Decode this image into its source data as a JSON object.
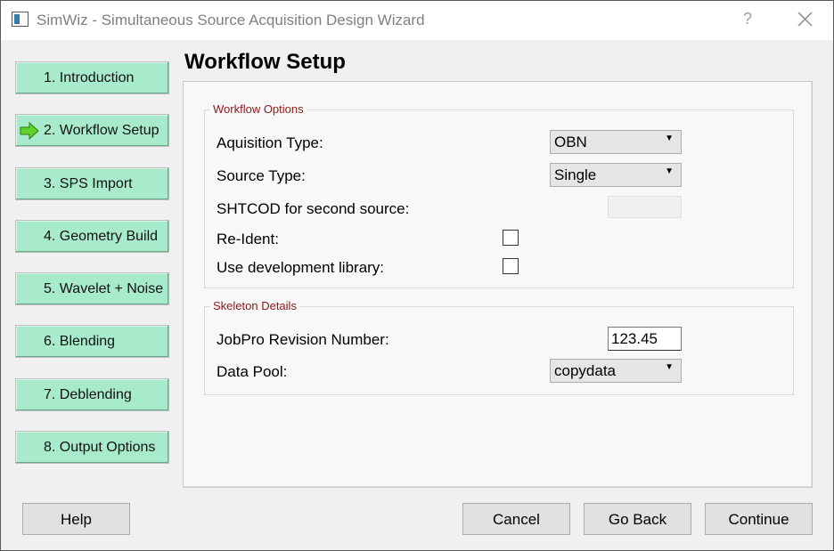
{
  "window": {
    "title": "SimWiz - Simultaneous Source Acquisition Design Wizard",
    "help_glyph": "?",
    "icon": "app-window-icon"
  },
  "nav": {
    "items": [
      {
        "label": "1. Introduction",
        "active": false
      },
      {
        "label": "2. Workflow Setup",
        "active": true
      },
      {
        "label": "3. SPS Import",
        "active": false
      },
      {
        "label": "4. Geometry Build",
        "active": false
      },
      {
        "label": "5. Wavelet + Noise",
        "active": false
      },
      {
        "label": "6. Blending",
        "active": false
      },
      {
        "label": "7. Deblending",
        "active": false
      },
      {
        "label": "8. Output Options",
        "active": false
      }
    ],
    "active_indicator_icon": "green-arrow-icon",
    "button_color": "#a8ebcc"
  },
  "page": {
    "title": "Workflow Setup"
  },
  "workflow_options": {
    "group_title": "Workflow Options",
    "acquisition_type": {
      "label": "Aquisition Type:",
      "value": "OBN"
    },
    "source_type": {
      "label": "Source Type:",
      "value": "Single"
    },
    "shtcod": {
      "label": "SHTCOD for second source:",
      "value": ""
    },
    "re_ident": {
      "label": "Re-Ident:",
      "checked": false
    },
    "dev_library": {
      "label": "Use development library:",
      "checked": false
    }
  },
  "skeleton_details": {
    "group_title": "Skeleton Details",
    "jobpro_revision": {
      "label": "JobPro Revision Number:",
      "value": "123.45"
    },
    "data_pool": {
      "label": "Data Pool:",
      "value": "copydata"
    }
  },
  "footer": {
    "help_label": "Help",
    "cancel_label": "Cancel",
    "goback_label": "Go Back",
    "continue_label": "Continue"
  },
  "colors": {
    "group_title": "#8b1a1a",
    "background": "#f0f0f0"
  }
}
